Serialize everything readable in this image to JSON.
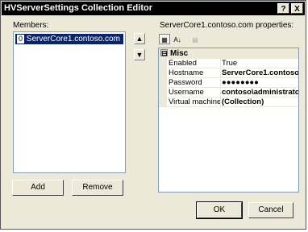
{
  "window": {
    "title": "HVServerSettings Collection Editor"
  },
  "titlebar_buttons": {
    "help": "?",
    "close": "X"
  },
  "members": {
    "label": "Members:",
    "items": [
      {
        "index": "0",
        "name": "ServerCore1.contoso.com"
      }
    ]
  },
  "reorder": {
    "up_glyph": "▲",
    "down_glyph": "▼"
  },
  "buttons": {
    "add": "Add",
    "remove": "Remove",
    "ok": "OK",
    "cancel": "Cancel"
  },
  "properties": {
    "label": "ServerCore1.contoso.com properties:",
    "toolbar": {
      "categorized_glyph": "▦",
      "alphabetical_glyph": "A↓",
      "pages_glyph": "▤"
    },
    "category": {
      "toggle": "⊟",
      "name": "Misc"
    },
    "rows": [
      {
        "name": "Enabled",
        "value": "True",
        "bold": false
      },
      {
        "name": "Hostname",
        "value": "ServerCore1.contoso",
        "bold": true
      },
      {
        "name": "Password",
        "value": "●●●●●●●●",
        "bold": false
      },
      {
        "name": "Username",
        "value": "contoso\\administrato",
        "bold": true
      },
      {
        "name": "Virtual machine lis",
        "value": "(Collection)",
        "bold": true
      }
    ]
  }
}
